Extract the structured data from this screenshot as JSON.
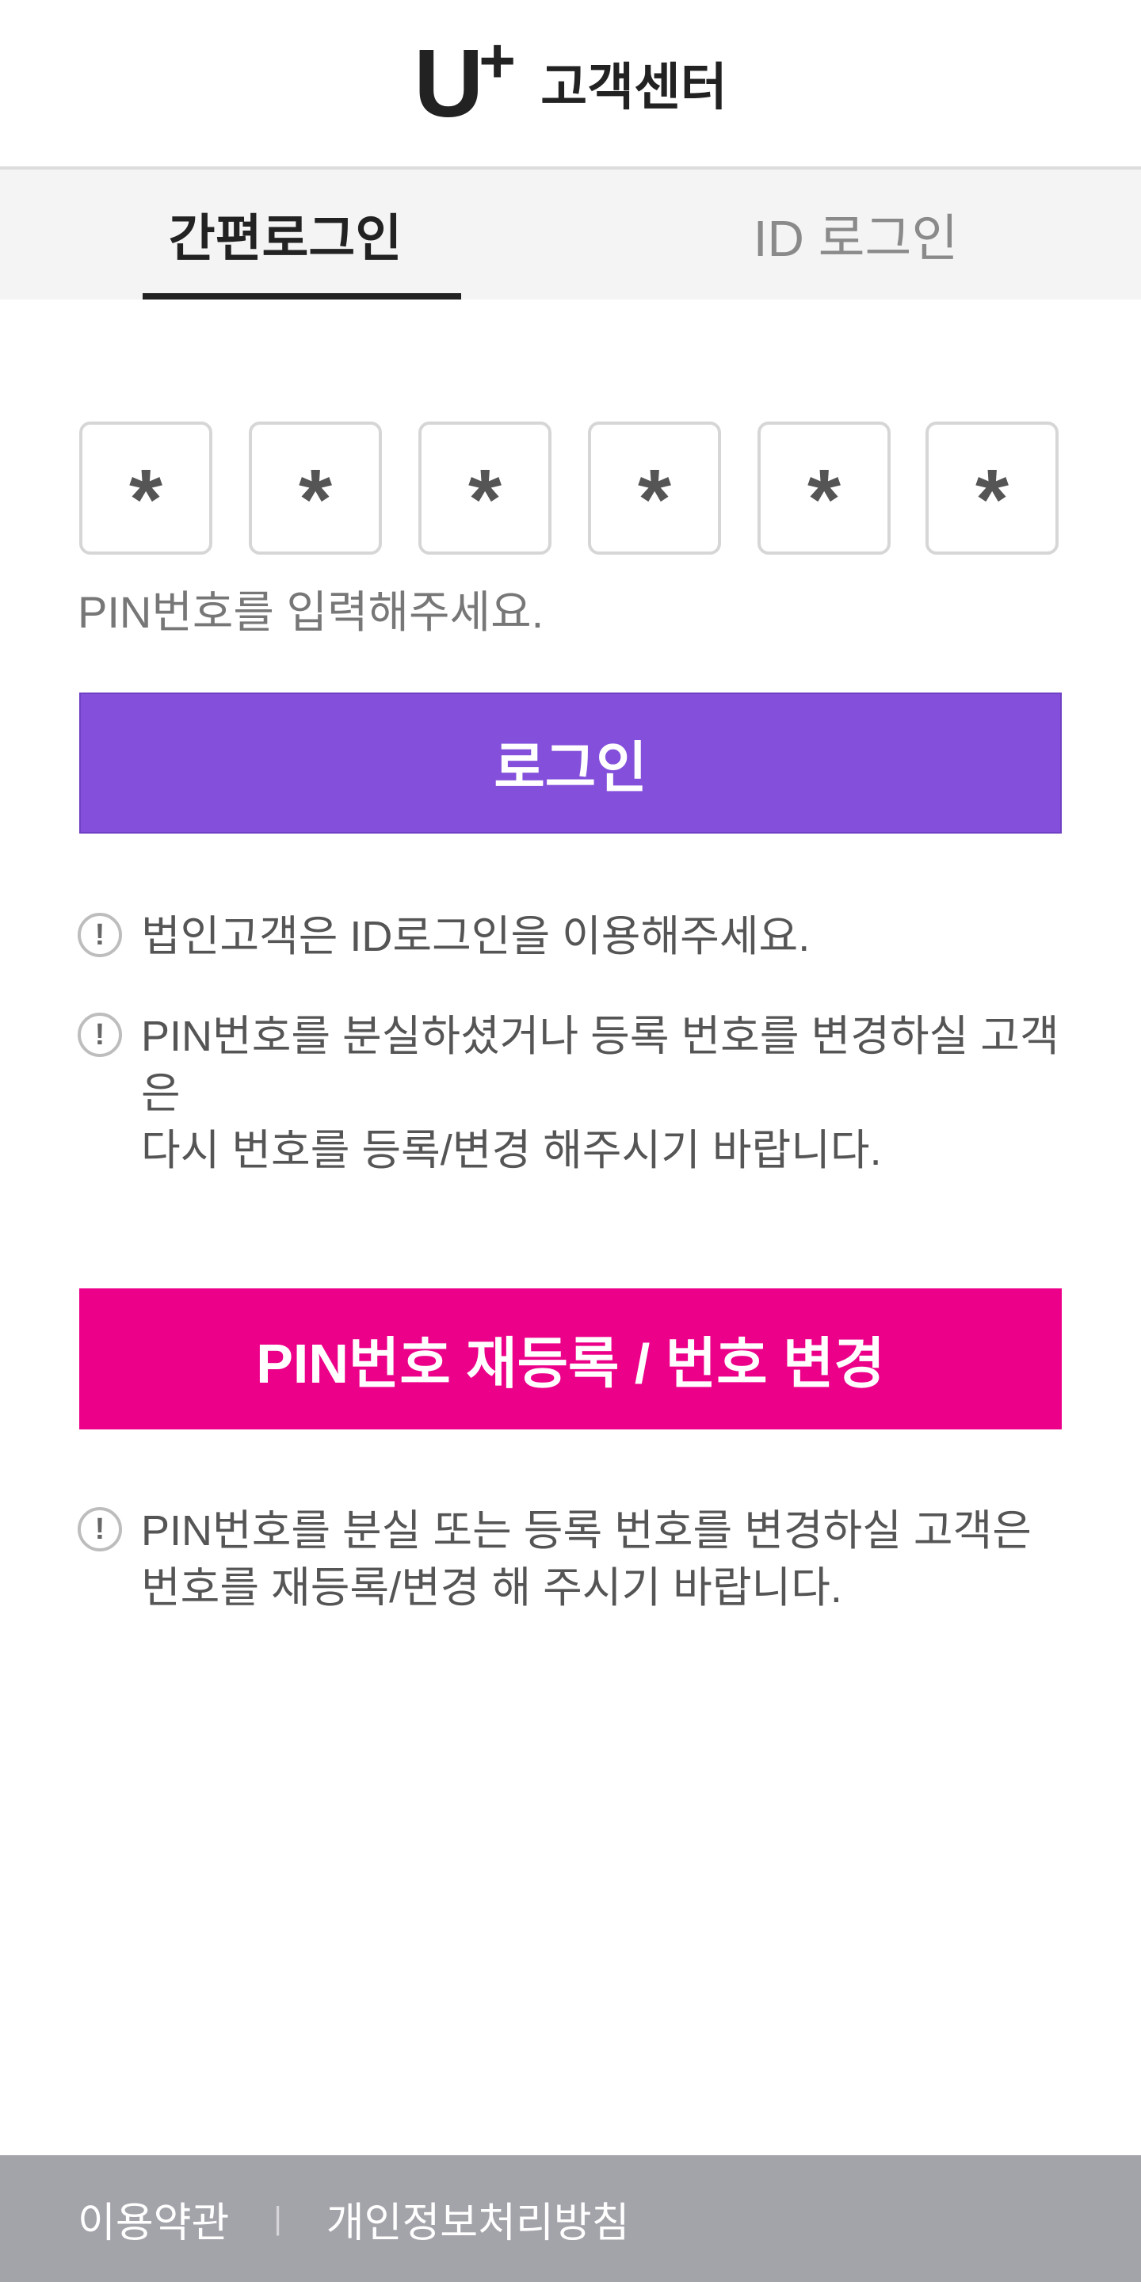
{
  "header": {
    "logo_text": "U",
    "logo_plus": "+",
    "title": "고객센터"
  },
  "tabs": [
    {
      "label": "간편로그인",
      "active": true
    },
    {
      "label": "ID 로그인",
      "active": false
    }
  ],
  "pin": {
    "masked_digits": [
      "*",
      "*",
      "*",
      "*",
      "*",
      "*"
    ],
    "hint": "PIN번호를 입력해주세요."
  },
  "buttons": {
    "login_label": "로그인",
    "pin_reset_label": "PIN번호 재등록 / 번호 변경"
  },
  "notices": {
    "icon_glyph": "!",
    "corporate": "법인고객은 ID로그인을 이용해주세요.",
    "lost_line1": "PIN번호를 분실하셨거나 등록 번호를 변경하실 고객은",
    "lost_line2": "다시 번호를 등록/변경 해주시기 바랍니다.",
    "reset_line1": "PIN번호를 분실 또는 등록 번호를 변경하실 고객은",
    "reset_line2": "번호를 재등록/변경 해 주시기 바랍니다."
  },
  "footer": {
    "terms": "이용약관",
    "divider": "|",
    "privacy": "개인정보처리방침"
  },
  "colors": {
    "login_button": "#8450db",
    "pin_button": "#ec0089",
    "footer_bg": "#a3a3aa",
    "tab_bg": "#f4f4f4"
  }
}
